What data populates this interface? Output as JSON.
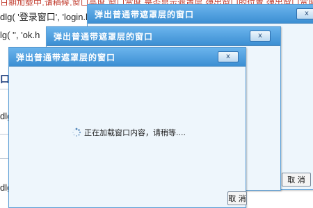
{
  "background": {
    "top_strip": "日期加载中,请稍候,窗口高度,窗口宽度,是否显示遮罩层,弹出窗口的位置,弹出窗口宽度高度,弹出窗口是否有关闭按钮",
    "code_lines": [
      "dlg( '登录窗口', 'login.h",
      "lg( '', 'ok.h",
      "dlg",
      "dlg"
    ],
    "blue_char": "口"
  },
  "dialogs": [
    {
      "title": "弹出普通带遮罩层的窗口",
      "close_icon": "x"
    },
    {
      "title": "弹出普通带遮罩层的窗口",
      "close_icon": "x",
      "cancel_label": "取 消"
    },
    {
      "title": "弹出普通带遮罩层的窗口",
      "close_icon": "x",
      "cancel_label": "取 消"
    }
  ],
  "loading": {
    "text": "正在加载窗口内容，请稍等...."
  }
}
